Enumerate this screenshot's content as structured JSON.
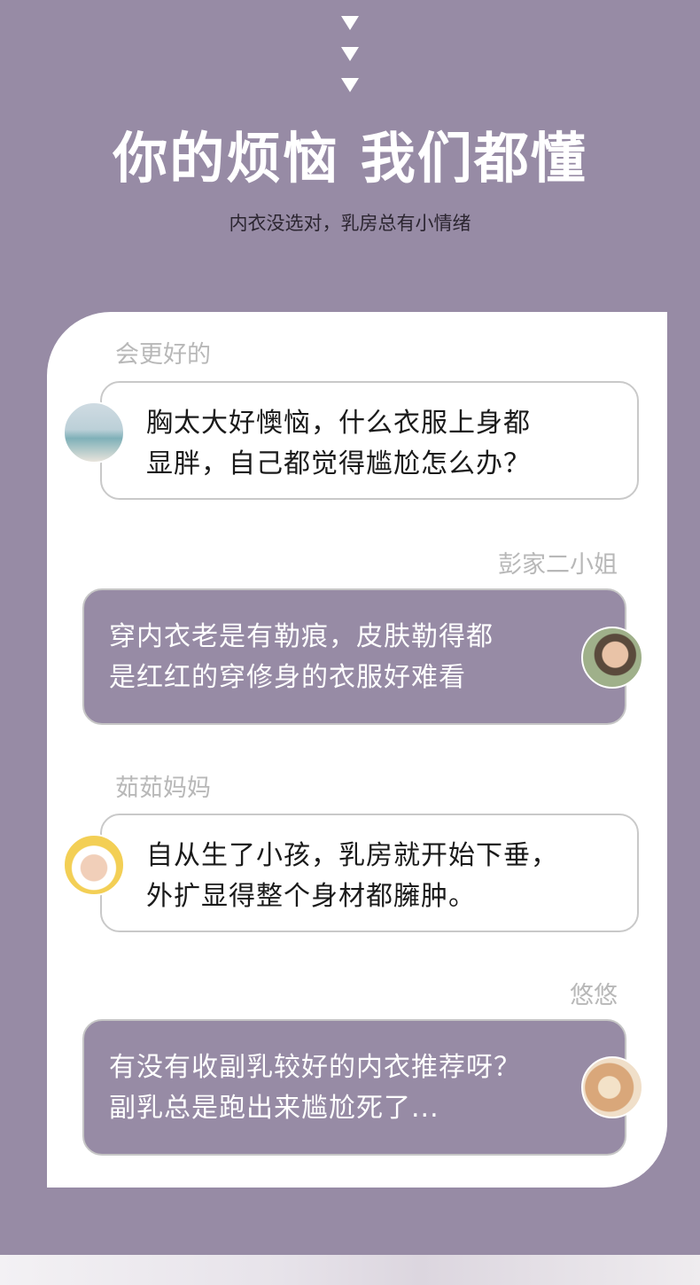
{
  "header": {
    "title": "你的烦恼 我们都懂",
    "subtitle": "内衣没选对，乳房总有小情绪"
  },
  "messages": [
    {
      "name": "会更好的",
      "lines": [
        "胸太大好懊恼，什么衣服上身都",
        "显胖，自己都觉得尴尬怎么办？"
      ]
    },
    {
      "name": "彭家二小姐",
      "lines": [
        "穿内衣老是有勒痕，皮肤勒得都",
        "是红红的穿修身的衣服好难看"
      ]
    },
    {
      "name": "茹茹妈妈",
      "lines": [
        "自从生了小孩，乳房就开始下垂，",
        "外扩显得整个身材都臃肿。"
      ]
    },
    {
      "name": "悠悠",
      "lines": [
        "有没有收副乳较好的内衣推荐呀？",
        "副乳总是跑出来尴尬死了..."
      ]
    }
  ],
  "colors": {
    "background": "#978ba5",
    "card": "#ffffff",
    "name_text": "#b8b8b8"
  }
}
